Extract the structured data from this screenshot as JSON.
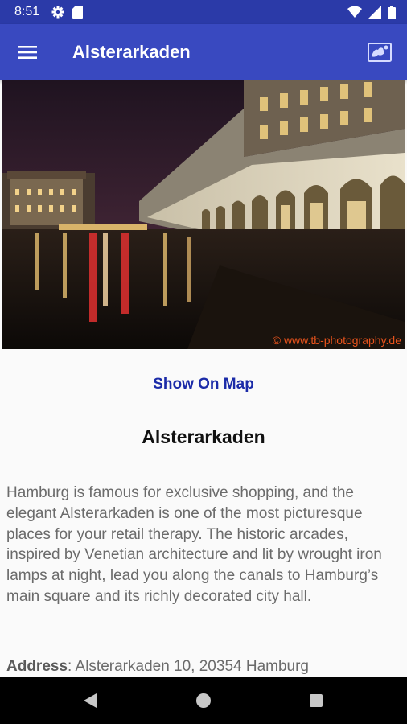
{
  "status_bar": {
    "time": "8:51"
  },
  "app_bar": {
    "title": "Alsterarkaden"
  },
  "hero": {
    "watermark": "© www.tb-photography.de"
  },
  "content": {
    "show_on_map": "Show On Map",
    "title": "Alsterarkaden",
    "description": "Hamburg is famous for exclusive shopping, and the elegant Alsterarkaden is one of the most picturesque places for your retail therapy. The historic arcades, inspired by Venetian architecture and lit by wrought iron lamps at night, lead you along the canals to Hamburg’s main square and its richly decorated city hall.",
    "address_label": "Address",
    "address_value": ": Alsterarkaden 10, 20354 Hamburg"
  },
  "icons": [
    "settings-icon",
    "sd-card-icon",
    "wifi-icon",
    "signal-icon",
    "battery-icon",
    "menu-icon",
    "map-icon",
    "back-icon",
    "home-icon",
    "recents-icon"
  ],
  "colors": {
    "status_bar": "#2b3aa8",
    "app_bar": "#3949c0",
    "link": "#1b2ba8",
    "body_text": "#6b6b6b"
  }
}
